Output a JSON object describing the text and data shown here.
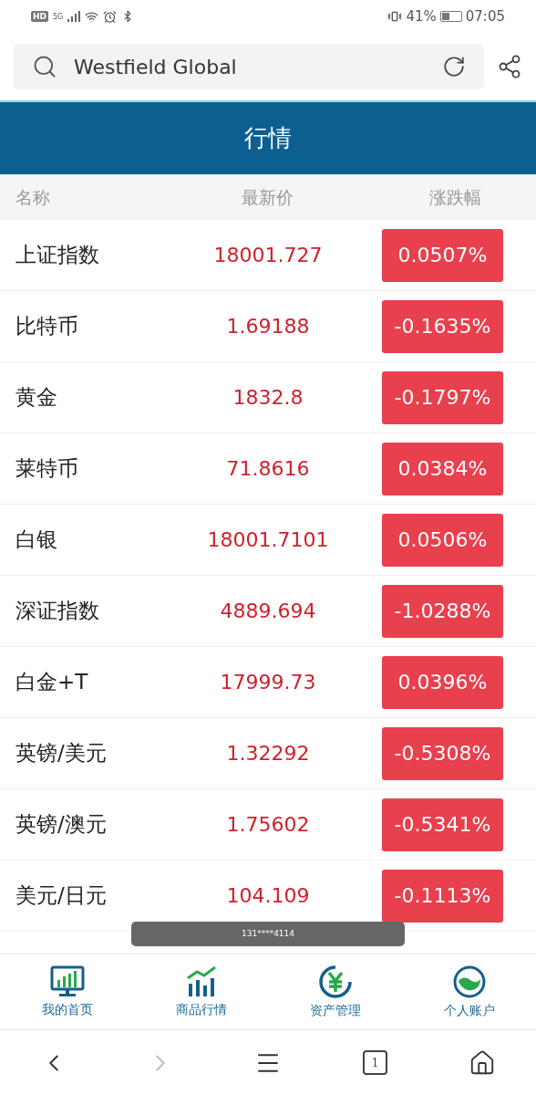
{
  "status_bar": {
    "network_badge": "HD",
    "network_type": "5G",
    "battery": "41%",
    "time": "07:05"
  },
  "search": {
    "value": "Westfield Global"
  },
  "header": {
    "title": "行情"
  },
  "table": {
    "columns": [
      "名称",
      "最新价",
      "涨跌幅"
    ],
    "rows": [
      {
        "name": "上证指数",
        "price": "18001.727",
        "change": "0.0507%"
      },
      {
        "name": "比特币",
        "price": "1.69188",
        "change": "-0.1635%"
      },
      {
        "name": "黄金",
        "price": "1832.8",
        "change": "-0.1797%"
      },
      {
        "name": "莱特币",
        "price": "71.8616",
        "change": "0.0384%"
      },
      {
        "name": "白银",
        "price": "18001.7101",
        "change": "0.0506%"
      },
      {
        "name": "深证指数",
        "price": "4889.694",
        "change": "-1.0288%"
      },
      {
        "name": "白金+T",
        "price": "17999.73",
        "change": "0.0396%"
      },
      {
        "name": "英镑/美元",
        "price": "1.32292",
        "change": "-0.5308%"
      },
      {
        "name": "英镑/澳元",
        "price": "1.75602",
        "change": "-0.5341%"
      },
      {
        "name": "美元/日元",
        "price": "104.109",
        "change": "-0.1113%"
      }
    ]
  },
  "toast": {
    "text": "131****4114"
  },
  "bottom_nav": [
    {
      "kind": "home",
      "label": "我的首页"
    },
    {
      "kind": "market",
      "label": "商品行情"
    },
    {
      "kind": "assets",
      "label": "资产管理"
    },
    {
      "kind": "account",
      "label": "个人账户"
    }
  ],
  "browser_bar": {
    "back_disabled": false,
    "forward_disabled": true,
    "tab_count": "1"
  }
}
